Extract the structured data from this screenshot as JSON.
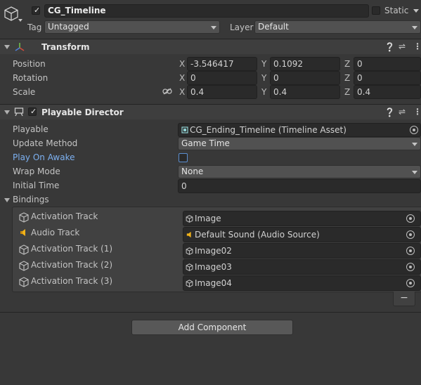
{
  "gameobject": {
    "active": true,
    "name": "CG_Timeline",
    "static_label": "Static",
    "static_checked": false,
    "tag_label": "Tag",
    "tag_value": "Untagged",
    "layer_label": "Layer",
    "layer_value": "Default"
  },
  "transform": {
    "title": "Transform",
    "position_label": "Position",
    "rotation_label": "Rotation",
    "scale_label": "Scale",
    "axis_x": "X",
    "axis_y": "Y",
    "axis_z": "Z",
    "position": {
      "x": "-3.546417",
      "y": "0.1092",
      "z": "0"
    },
    "rotation": {
      "x": "0",
      "y": "0",
      "z": "0"
    },
    "scale": {
      "x": "0.4",
      "y": "0.4",
      "z": "0.4"
    }
  },
  "playable_director": {
    "title": "Playable Director",
    "enabled": true,
    "playable_label": "Playable",
    "playable_value": "CG_Ending_Timeline (Timeline Asset)",
    "update_method_label": "Update Method",
    "update_method_value": "Game Time",
    "play_on_awake_label": "Play On Awake",
    "play_on_awake_checked": false,
    "wrap_mode_label": "Wrap Mode",
    "wrap_mode_value": "None",
    "initial_time_label": "Initial Time",
    "initial_time_value": "0",
    "bindings_label": "Bindings",
    "bindings": [
      {
        "track": "Activation Track",
        "track_icon": "cube-icon",
        "value": "Image",
        "value_icon": "cube-icon"
      },
      {
        "track": "Audio Track",
        "track_icon": "speaker-icon",
        "value": "Default Sound (Audio Source)",
        "value_icon": "speaker-icon"
      },
      {
        "track": "Activation Track (1)",
        "track_icon": "cube-icon",
        "value": "Image02",
        "value_icon": "cube-icon"
      },
      {
        "track": "Activation Track (2)",
        "track_icon": "cube-icon",
        "value": "Image03",
        "value_icon": "cube-icon"
      },
      {
        "track": "Activation Track (3)",
        "track_icon": "cube-icon",
        "value": "Image04",
        "value_icon": "cube-icon"
      }
    ],
    "remove_label": "−"
  },
  "add_component_label": "Add Component",
  "colors": {
    "background": "#383838",
    "field": "#2a2a2a",
    "accent_label": "#7cb0f0",
    "speaker": "#f0b21a"
  }
}
